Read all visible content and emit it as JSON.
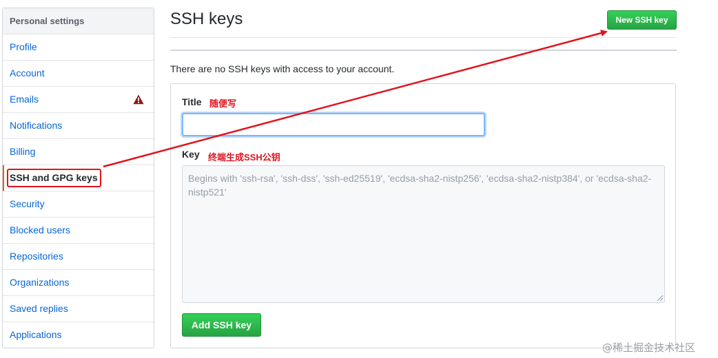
{
  "sidebar": {
    "header": "Personal settings",
    "items": [
      {
        "label": "Profile"
      },
      {
        "label": "Account"
      },
      {
        "label": "Emails"
      },
      {
        "label": "Notifications"
      },
      {
        "label": "Billing"
      },
      {
        "label": "SSH and GPG keys"
      },
      {
        "label": "Security"
      },
      {
        "label": "Blocked users"
      },
      {
        "label": "Repositories"
      },
      {
        "label": "Organizations"
      },
      {
        "label": "Saved replies"
      },
      {
        "label": "Applications"
      }
    ],
    "selected_index": 5,
    "emails_badge_icon": "warning-triangle-icon"
  },
  "main": {
    "title": "SSH keys",
    "new_key_button": "New SSH key",
    "empty_message": "There are no SSH keys with access to your account.",
    "form": {
      "title_label": "Title",
      "title_value": "",
      "key_label": "Key",
      "key_value": "",
      "key_placeholder": "Begins with 'ssh-rsa', 'ssh-dss', 'ssh-ed25519', 'ecdsa-sha2-nistp256', 'ecdsa-sha2-nistp384', or 'ecdsa-sha2-nistp521'",
      "submit_button": "Add SSH key"
    }
  },
  "annotations": {
    "title_note": "随便写",
    "key_note": "终端生成SSH公钥",
    "arrow_color": "#e0141e"
  },
  "watermark": "@稀土掘金技术社区",
  "colors": {
    "link": "#0366d6",
    "button_green": "#28a745",
    "selected_border": "#e36209",
    "annotation_red": "#e0141e"
  }
}
